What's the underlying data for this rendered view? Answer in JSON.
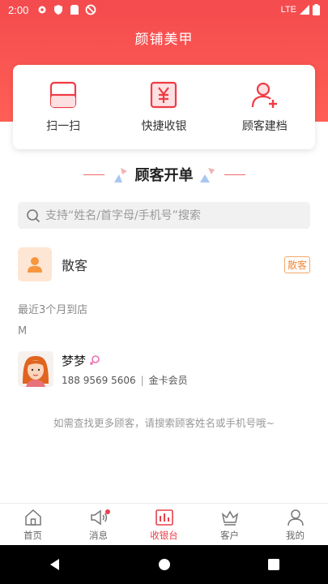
{
  "status_bar": {
    "time": "2:00",
    "network": "LTE"
  },
  "app": {
    "title": "颜铺美甲"
  },
  "actions": [
    {
      "label": "扫一扫"
    },
    {
      "label": "快捷收银"
    },
    {
      "label": "顾客建档"
    }
  ],
  "section": {
    "title": "顾客开单"
  },
  "search": {
    "placeholder": "支持“姓名/首字母/手机号”搜索"
  },
  "walk_in": {
    "name": "散客",
    "tag": "散客"
  },
  "recent": {
    "heading": "最近3个月到店",
    "index_letter": "M"
  },
  "members": [
    {
      "name": "梦梦",
      "phone": "188 9569 5606",
      "separator": "|",
      "level": "金卡会员"
    }
  ],
  "hint": "如需查找更多顾客，请搜索顾客姓名或手机号哦~",
  "tabs": [
    {
      "label": "首页"
    },
    {
      "label": "消息"
    },
    {
      "label": "收银台"
    },
    {
      "label": "客户"
    },
    {
      "label": "我的"
    }
  ],
  "colors": {
    "primary": "#f44b4e",
    "accent_orange": "#f08a3c",
    "active_tab": "#e8404a"
  }
}
